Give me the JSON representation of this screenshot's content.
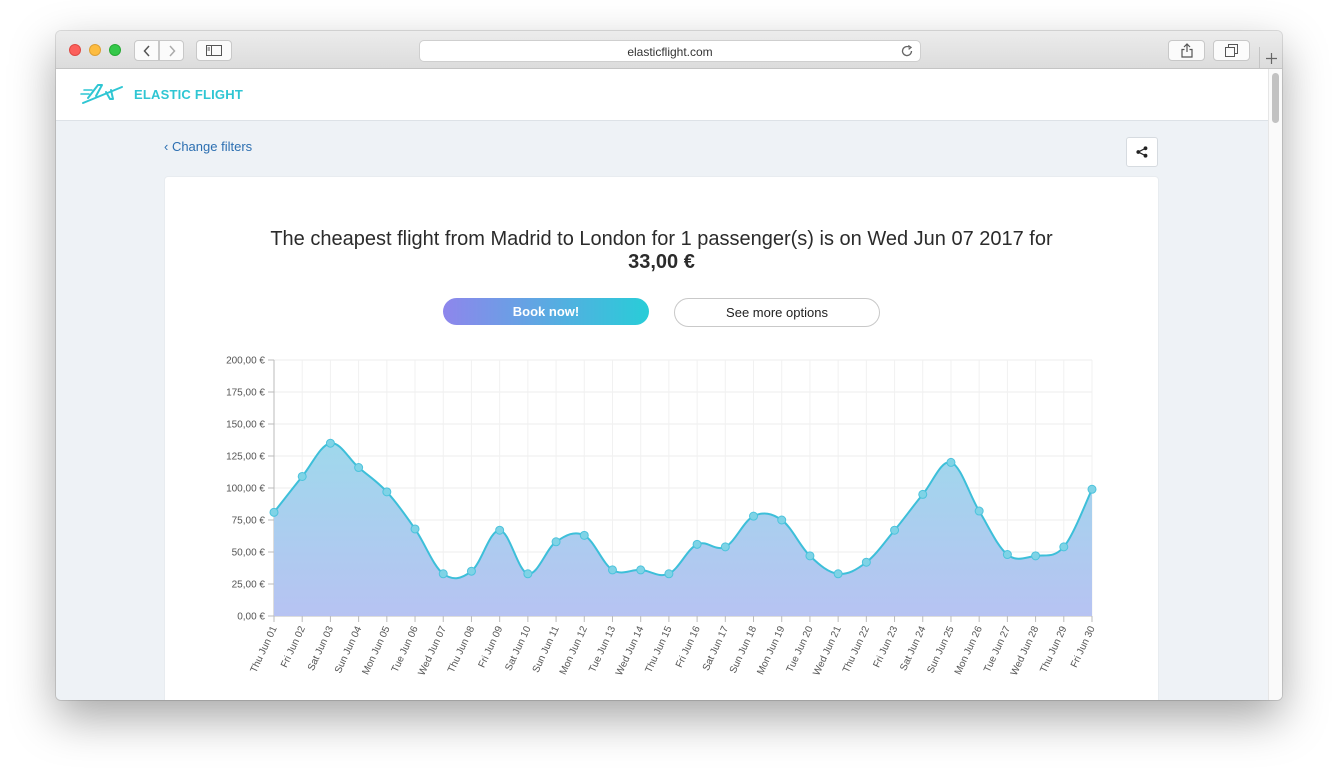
{
  "browser": {
    "url": "elasticflight.com"
  },
  "site": {
    "logo_text": "ELASTIC FLIGHT",
    "change_filters": "‹ Change filters"
  },
  "result": {
    "headline": "The cheapest flight from Madrid to London for 1 passenger(s) is on Wed Jun 07 2017 for",
    "price": "33,00 €",
    "book_label": "Book now!",
    "more_label": "See more options"
  },
  "colors": {
    "accent": "#2fc6d3",
    "link": "#2c6fb1",
    "line": "#3dbfd9",
    "gradient_start": "#8e86ec",
    "gradient_end": "#28cdd8"
  },
  "icons": {
    "share": "share-icon",
    "reload": "reload-icon",
    "plane": "plane-icon"
  },
  "chart_data": {
    "type": "area",
    "title": "",
    "xlabel": "",
    "ylabel": "",
    "ylim": [
      0,
      200
    ],
    "yticks": [
      0,
      25,
      50,
      75,
      100,
      125,
      150,
      175,
      200
    ],
    "ytick_labels": [
      "0,00 €",
      "25,00 €",
      "50,00 €",
      "75,00 €",
      "100,00 €",
      "125,00 €",
      "150,00 €",
      "175,00 €",
      "200,00 €"
    ],
    "grid": true,
    "categories": [
      "Thu Jun 01",
      "Fri Jun 02",
      "Sat Jun 03",
      "Sun Jun 04",
      "Mon Jun 05",
      "Tue Jun 06",
      "Wed Jun 07",
      "Thu Jun 08",
      "Fri Jun 09",
      "Sat Jun 10",
      "Sun Jun 11",
      "Mon Jun 12",
      "Tue Jun 13",
      "Wed Jun 14",
      "Thu Jun 15",
      "Fri Jun 16",
      "Sat Jun 17",
      "Sun Jun 18",
      "Mon Jun 19",
      "Tue Jun 20",
      "Wed Jun 21",
      "Thu Jun 22",
      "Fri Jun 23",
      "Sat Jun 24",
      "Sun Jun 25",
      "Mon Jun 26",
      "Tue Jun 27",
      "Wed Jun 28",
      "Thu Jun 29",
      "Fri Jun 30"
    ],
    "values": [
      81,
      109,
      135,
      116,
      97,
      68,
      33,
      35,
      67,
      33,
      58,
      63,
      36,
      36,
      33,
      56,
      54,
      78,
      75,
      47,
      33,
      42,
      67,
      95,
      120,
      82,
      48,
      47,
      54,
      99
    ]
  }
}
